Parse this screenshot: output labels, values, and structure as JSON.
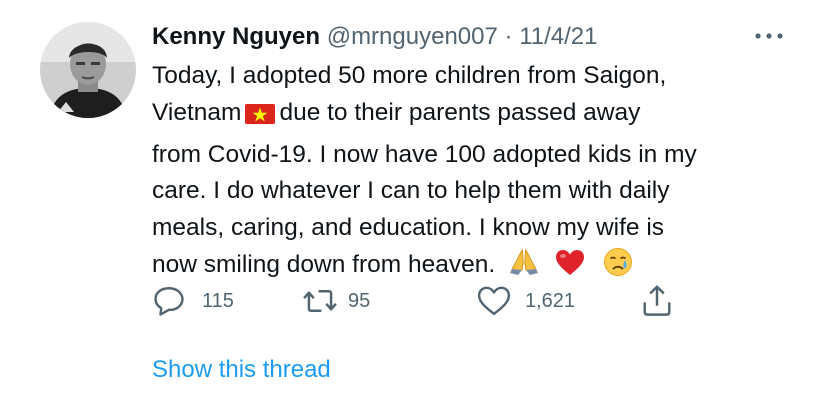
{
  "tweet": {
    "author": {
      "name": "Kenny Nguyen",
      "handle": "@mrnguyen007",
      "avatar_icon": "person-avatar"
    },
    "dot": "·",
    "timestamp": "11/4/21",
    "more_icon": "more-dots-icon",
    "text_lines": [
      "Today, I adopted 50 more children from Saigon,",
      "Vietnam",
      "due to their parents passed away",
      "from Covid-19. I now have 100 adopted kids in my",
      "care. I do whatever I can to help them with daily",
      "meals, caring, and education. I know my wife is",
      "now smiling down from heaven."
    ],
    "emojis": [
      "vietnam-flag-icon",
      "folded-hands-icon",
      "red-heart-icon",
      "crying-face-icon"
    ],
    "actions": {
      "reply": {
        "icon": "reply-icon",
        "count": "115"
      },
      "retweet": {
        "icon": "retweet-icon",
        "count": "95"
      },
      "like": {
        "icon": "like-icon",
        "count": "1,621"
      },
      "share": {
        "icon": "share-icon"
      }
    },
    "show_thread": "Show this thread"
  },
  "colors": {
    "text": "#0f1419",
    "secondary": "#536471",
    "link": "#1d9bf0",
    "flag_red": "#da251d",
    "flag_star": "#ffff00",
    "heart": "#e0222b"
  }
}
